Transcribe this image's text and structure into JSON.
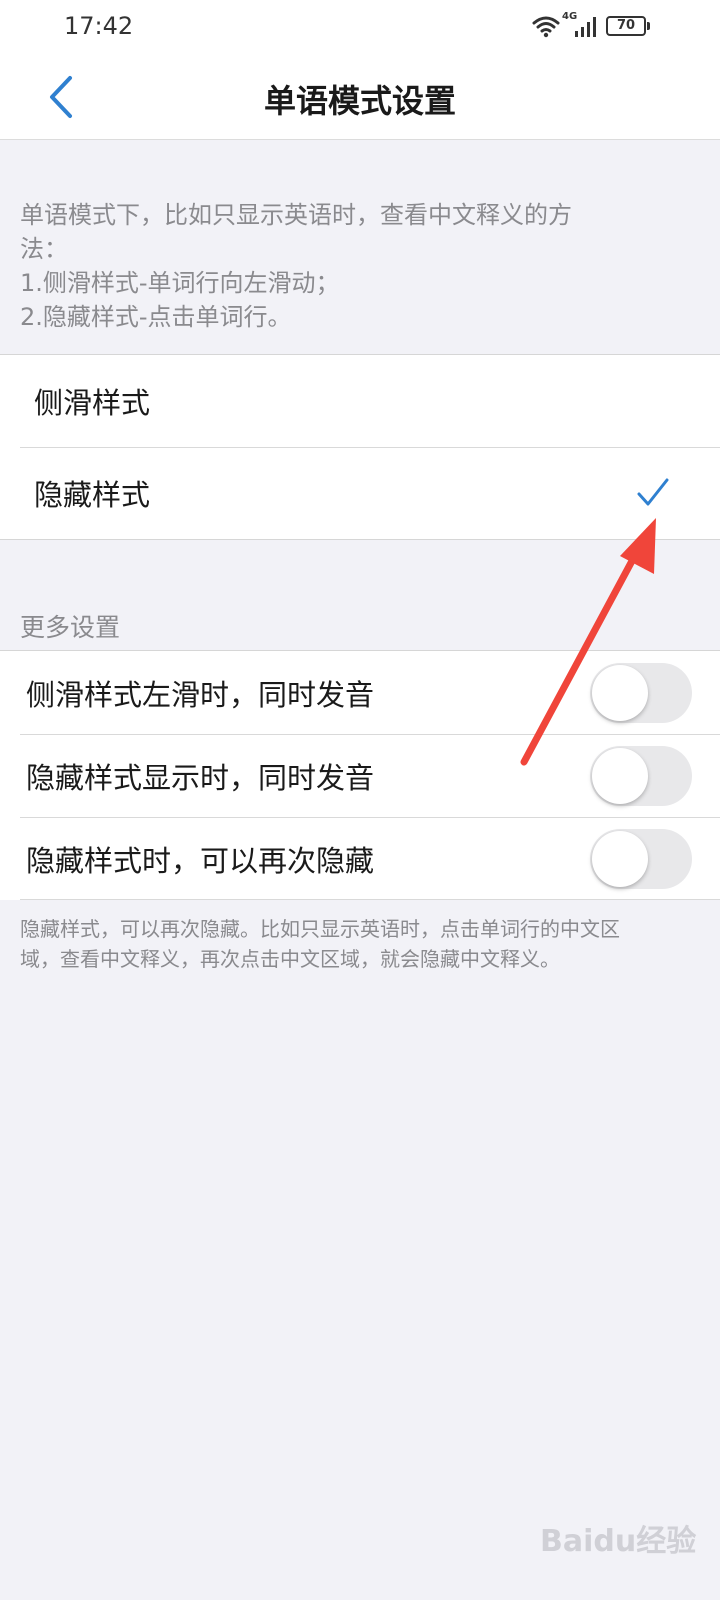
{
  "status": {
    "time": "17:42",
    "network": "4G",
    "battery": "70"
  },
  "nav": {
    "title": "单语模式设置"
  },
  "intro": {
    "lines": [
      "单语模式下，比如只显示英语时，查看中文释义的方",
      "法：",
      "1.侧滑样式-单词行向左滑动；",
      "2.隐藏样式-点击单词行。"
    ]
  },
  "styles": {
    "options": [
      {
        "label": "侧滑样式",
        "selected": false
      },
      {
        "label": "隐藏样式",
        "selected": true
      }
    ]
  },
  "more": {
    "header": "更多设置",
    "items": [
      {
        "label": "侧滑样式左滑时，同时发音",
        "on": false
      },
      {
        "label": "隐藏样式显示时，同时发音",
        "on": false
      },
      {
        "label": "隐藏样式时，可以再次隐藏",
        "on": false
      }
    ]
  },
  "footnote": {
    "lines": [
      "隐藏样式，可以再次隐藏。比如只显示英语时，点击单词行的中文区",
      "域，查看中文释义，再次点击中文区域，就会隐藏中文释义。"
    ]
  },
  "watermark": "Baidu经验",
  "colors": {
    "accent": "#2f80d0",
    "annotation_arrow": "#f0453a",
    "toggle_off": "#e8e8ea"
  }
}
